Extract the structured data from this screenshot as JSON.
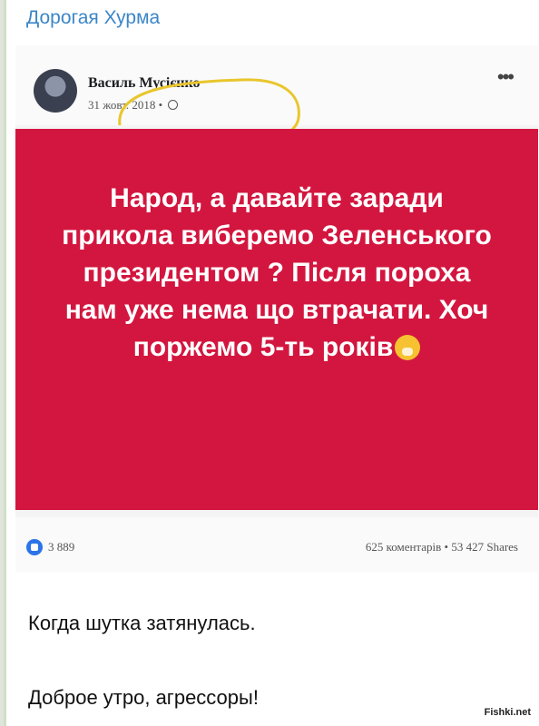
{
  "channel": {
    "name": "Дорогая Хурма"
  },
  "post": {
    "author": "Василь Мусієнко",
    "date": "31 жовт. 2018 •",
    "text": "Народ, а давайте заради прикола виберемо Зеленського президентом ? Після пороха нам уже нема що втрачати. Хоч поржемо 5-ть років",
    "likes": "3 889",
    "stats": "625 коментарів • 53 427 Shares",
    "card_color": "#d3163f"
  },
  "caption": {
    "line1": "Когда шутка затянулась.",
    "line2": "Доброе утро, агрессоры!"
  },
  "watermark": "Fishki.net",
  "icons": [
    "avatar",
    "globe-icon",
    "more-icon",
    "like-icon",
    "emoji-icon"
  ]
}
